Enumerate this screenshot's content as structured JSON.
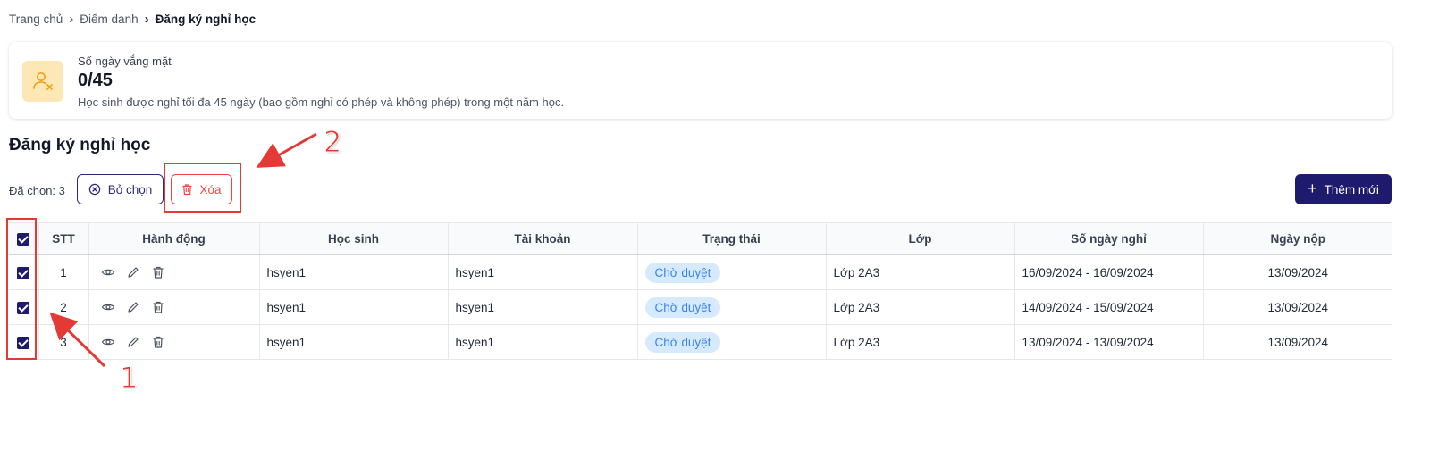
{
  "breadcrumb": {
    "items": [
      "Trang chủ",
      "Điểm danh",
      "Đăng ký nghỉ học"
    ]
  },
  "summary": {
    "label": "Số ngày vắng mặt",
    "value": "0/45",
    "note": "Học sinh được nghỉ tối đa 45 ngày (bao gồm nghỉ có phép và không phép) trong một năm học.",
    "icon": "user-x-icon",
    "icon_bg": "#fde8b5",
    "icon_color": "#f59e0b"
  },
  "section": {
    "title": "Đăng ký nghỉ học"
  },
  "toolbar": {
    "selected_text": "Đã chọn: 3",
    "deselect_label": "Bỏ chọn",
    "delete_label": "Xóa",
    "add_label": "Thêm mới"
  },
  "table": {
    "columns": [
      "STT",
      "Hành động",
      "Học sinh",
      "Tài khoản",
      "Trạng thái",
      "Lớp",
      "Số ngày nghỉ",
      "Ngày nộp"
    ],
    "rows": [
      {
        "stt": "1",
        "student": "hsyen1",
        "account": "hsyen1",
        "status": "Chờ duyệt",
        "class": "Lớp 2A3",
        "days": "16/09/2024 - 16/09/2024",
        "submitted": "13/09/2024",
        "checked": true
      },
      {
        "stt": "2",
        "student": "hsyen1",
        "account": "hsyen1",
        "status": "Chờ duyệt",
        "class": "Lớp 2A3",
        "days": "14/09/2024 - 15/09/2024",
        "submitted": "13/09/2024",
        "checked": true
      },
      {
        "stt": "3",
        "student": "hsyen1",
        "account": "hsyen1",
        "status": "Chờ duyệt",
        "class": "Lớp 2A3",
        "days": "13/09/2024 - 13/09/2024",
        "submitted": "13/09/2024",
        "checked": true
      }
    ]
  },
  "annotations": {
    "label_1": "1",
    "label_2": "2",
    "color": "#e53935"
  },
  "colors": {
    "primary": "#1e1b6e",
    "danger": "#ef4444",
    "status_bg": "#d6eafe",
    "status_text": "#3b82f6"
  }
}
